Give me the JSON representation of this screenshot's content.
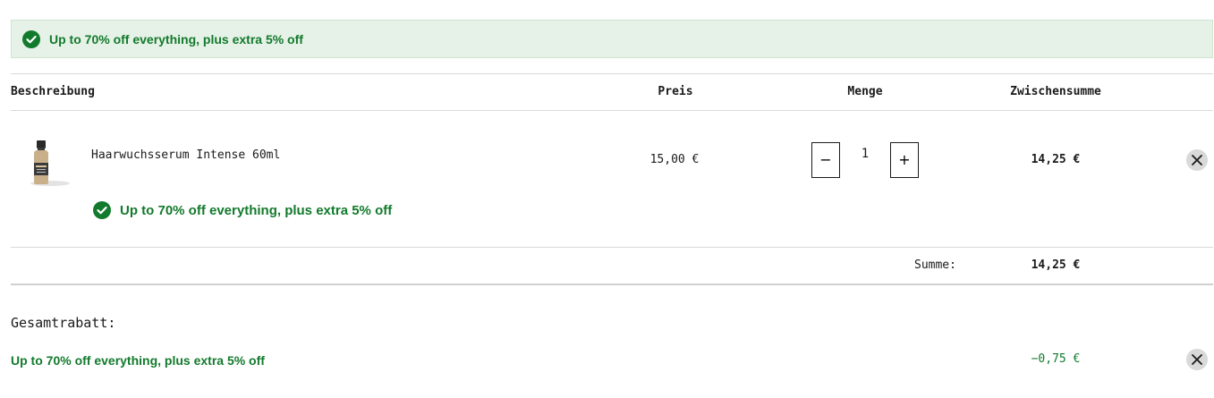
{
  "promo_banner": {
    "icon": "check-circle-icon",
    "text": "Up to 70% off everything, plus extra 5% off"
  },
  "table_header": {
    "description": "Beschreibung",
    "price": "Preis",
    "quantity": "Menge",
    "subtotal": "Zwischensumme"
  },
  "cart_item": {
    "image": "product-bottle-image",
    "name": "Haarwuchsserum Intense 60ml",
    "price": "15,00 €",
    "quantity": "1",
    "decrement_label": "−",
    "increment_label": "+",
    "subtotal": "14,25 €",
    "promo_text": "Up to 70% off everything, plus extra 5% off",
    "remove_icon": "close-icon"
  },
  "summary": {
    "label": "Summe:",
    "value": "14,25 €"
  },
  "total_discount": {
    "title": "Gesamtrabatt:",
    "promo_label": "Up to 70% off everything, plus extra 5% off",
    "value": "−0,75 €",
    "remove_icon": "close-icon"
  },
  "colors": {
    "promo_green": "#127a2c",
    "banner_bg": "#e6f1e7",
    "remove_bg": "#d9d9d9"
  }
}
